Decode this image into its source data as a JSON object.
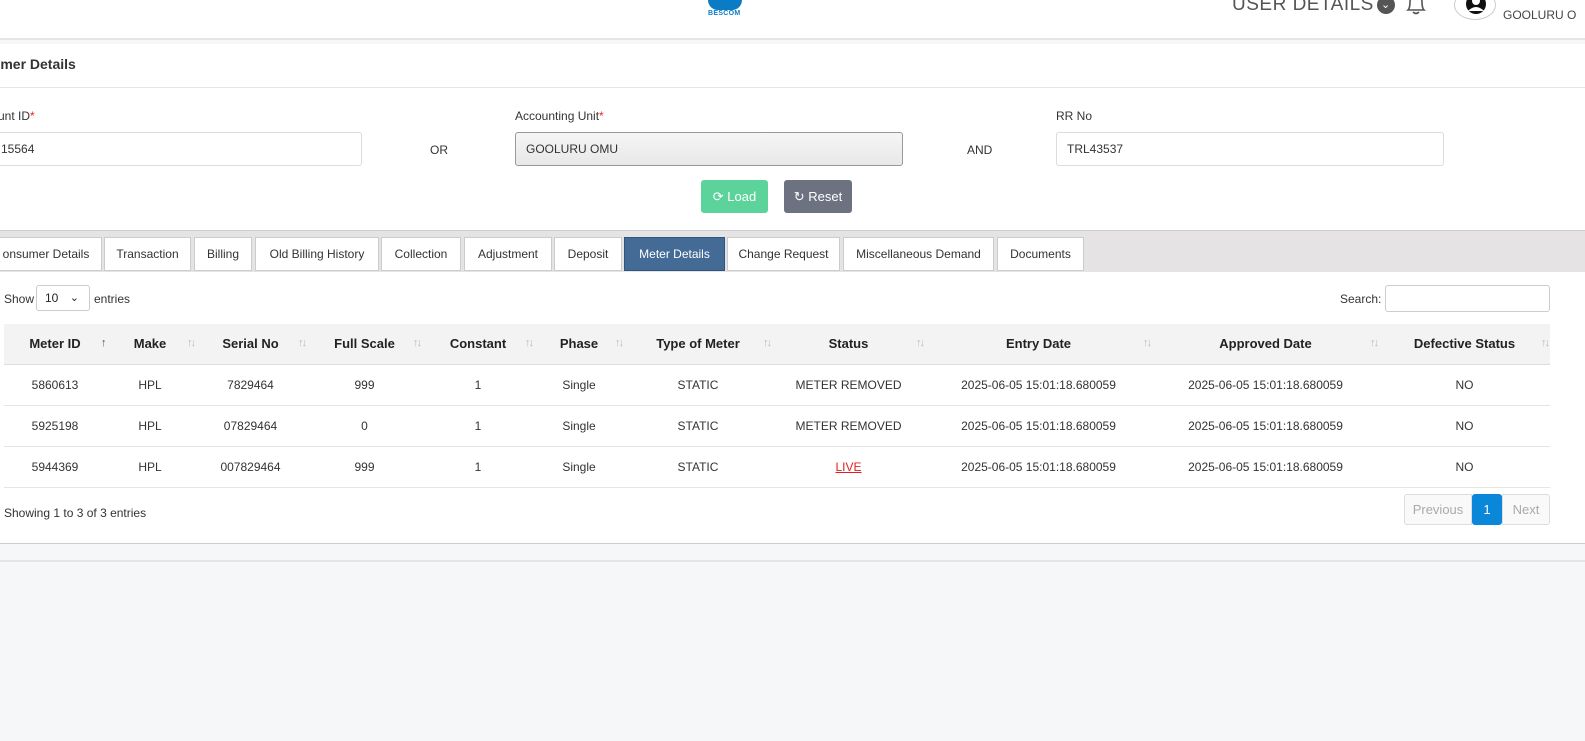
{
  "header": {
    "logo_text": "BESCOM",
    "user_details_label": "USER DETAILS",
    "username": "GOOLURU O"
  },
  "form": {
    "title": "sumer Details",
    "account_id_label": "unt ID",
    "account_id_value": "15564",
    "or_label": "OR",
    "accounting_unit_label": "Accounting Unit",
    "accounting_unit_value": "GOOLURU OMU",
    "and_label": "AND",
    "rr_no_label": "RR No",
    "rr_no_value": "TRL43537",
    "required_mark": "*",
    "load_label": "Load",
    "reset_label": "Reset"
  },
  "tabs": [
    {
      "label": "onsumer Details"
    },
    {
      "label": "Transaction"
    },
    {
      "label": "Billing"
    },
    {
      "label": "Old Billing History"
    },
    {
      "label": "Collection"
    },
    {
      "label": "Adjustment"
    },
    {
      "label": "Deposit"
    },
    {
      "label": "Meter Details"
    },
    {
      "label": "Change Request"
    },
    {
      "label": "Miscellaneous Demand"
    },
    {
      "label": "Documents"
    }
  ],
  "table_controls": {
    "show_label": "Show",
    "entries_label": "entries",
    "page_length": "10",
    "search_label": "Search:"
  },
  "table": {
    "headers": [
      "Meter ID",
      "Make",
      "Serial No",
      "Full Scale",
      "Constant",
      "Phase",
      "Type of Meter",
      "Status",
      "Entry Date",
      "Approved Date",
      "Defective Status"
    ],
    "rows": [
      [
        "5860613",
        "HPL",
        "7829464",
        "999",
        "1",
        "Single",
        "STATIC",
        "METER REMOVED",
        "2025-06-05 15:01:18.680059",
        "2025-06-05 15:01:18.680059",
        "NO"
      ],
      [
        "5925198",
        "HPL",
        "07829464",
        "0",
        "1",
        "Single",
        "STATIC",
        "METER REMOVED",
        "2025-06-05 15:01:18.680059",
        "2025-06-05 15:01:18.680059",
        "NO"
      ],
      [
        "5944369",
        "HPL",
        "007829464",
        "999",
        "1",
        "Single",
        "STATIC",
        "LIVE",
        "2025-06-05 15:01:18.680059",
        "2025-06-05 15:01:18.680059",
        "NO"
      ]
    ]
  },
  "pagination": {
    "info": "Showing 1 to 3 of 3 entries",
    "previous": "Previous",
    "current": "1",
    "next": "Next"
  },
  "colors": {
    "active_tab": "#436b96",
    "load_button": "#5cd39a",
    "reset_button": "#6c7280",
    "live_status": "#e02020",
    "page_current": "#0a87d9"
  }
}
